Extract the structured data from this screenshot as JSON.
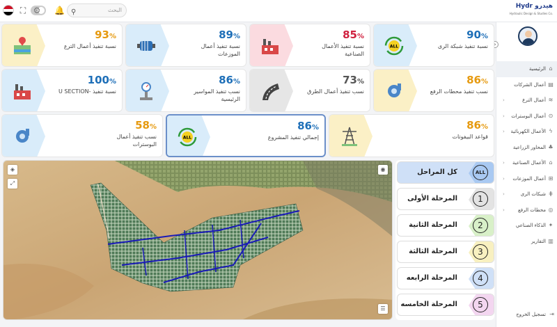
{
  "search": {
    "placeholder": "البحث"
  },
  "brand": {
    "name": "Hydr هيدرو",
    "tagline": "Hydraulic Design & Studies Co."
  },
  "sidebar": {
    "items": [
      {
        "label": "الرئيسية",
        "icon": "home-icon"
      },
      {
        "label": "أعمال الشركات",
        "icon": "building-icon"
      },
      {
        "label": "أعمال الترع",
        "icon": "canal-icon"
      },
      {
        "label": "أعمال البوسترات",
        "icon": "pump-icon"
      },
      {
        "label": "الأعمال الكهربائية",
        "icon": "electric-icon"
      },
      {
        "label": "المحاور الزراعية",
        "icon": "plant-icon"
      },
      {
        "label": "الأعمال الصناعية",
        "icon": "factory-icon"
      },
      {
        "label": "أعمال الموزعات",
        "icon": "distributor-icon"
      },
      {
        "label": "شبكات الرى",
        "icon": "network-icon"
      },
      {
        "label": "محطات الرفع",
        "icon": "station-icon"
      },
      {
        "label": "الذكاء الصناعي",
        "icon": "ai-icon"
      },
      {
        "label": "التقارير",
        "icon": "report-icon"
      }
    ],
    "logout": "تسجيل الخروج"
  },
  "cards": {
    "c1": {
      "value": "90",
      "label": "نسبة تنفيذ شبكة الرى",
      "color": "#1e6fb8",
      "bg": "#d9ecfa"
    },
    "c2": {
      "value": "85",
      "label": "نسبة تنفيذ الأعمال الصناعية",
      "color": "#d0213f",
      "bg": "#fbdbe0"
    },
    "c3": {
      "value": "89",
      "label": "نسبة تنفيذ أعمال الموزعات",
      "color": "#1e6fb8",
      "bg": "#d9ecfa"
    },
    "c4": {
      "value": "93",
      "label": "نسبة تنفيذ أعمال الترع",
      "color": "#e69a10",
      "bg": "#fbf0c6"
    },
    "c5": {
      "value": "86",
      "label": "نسب تنفيذ محطات الرفع",
      "color": "#e69a10",
      "bg": "#fbf0c6"
    },
    "c6": {
      "value": "73",
      "label": "نسب تنفيذ أعمال الطرق",
      "color": "#555555",
      "bg": "#e6e6e6"
    },
    "c7": {
      "value": "86",
      "label": "نسب تنفيذ المواسير الرئيسية",
      "color": "#1e6fb8",
      "bg": "#d9ecfa"
    },
    "c8": {
      "value": "100",
      "label": "نسبة تنفيذ -U SECTION",
      "color": "#1e6fb8",
      "bg": "#d9ecfa"
    },
    "c9": {
      "value": "86",
      "label": "قواعد البيفوتات",
      "color": "#e69a10",
      "bg": "#fbf0c6"
    },
    "c10": {
      "value": "86",
      "label": "إجمالي تنفيذ المشروع",
      "color": "#1e6fb8",
      "bg": "#d9ecfa"
    },
    "c11": {
      "value": "58",
      "label": "نسب تنفيذ أعمال البوسترات",
      "color": "#e69a10",
      "bg": "#fbf0c6"
    }
  },
  "percent_sign": "%",
  "phases": [
    {
      "label": "كل المراحل",
      "num": "ALL",
      "bg": "#a9c9f2"
    },
    {
      "label": "المرحلة الأولى",
      "num": "1",
      "bg": "#e3e3e3"
    },
    {
      "label": "المرحلة الثانية",
      "num": "2",
      "bg": "#d8f0c8"
    },
    {
      "label": "المرحلة الثالثة",
      "num": "3",
      "bg": "#f8f0c0"
    },
    {
      "label": "المرحلة الرابعه",
      "num": "4",
      "bg": "#cfe0f7"
    },
    {
      "label": "المرحلة الخامسه",
      "num": "5",
      "bg": "#f3d6f0"
    }
  ]
}
